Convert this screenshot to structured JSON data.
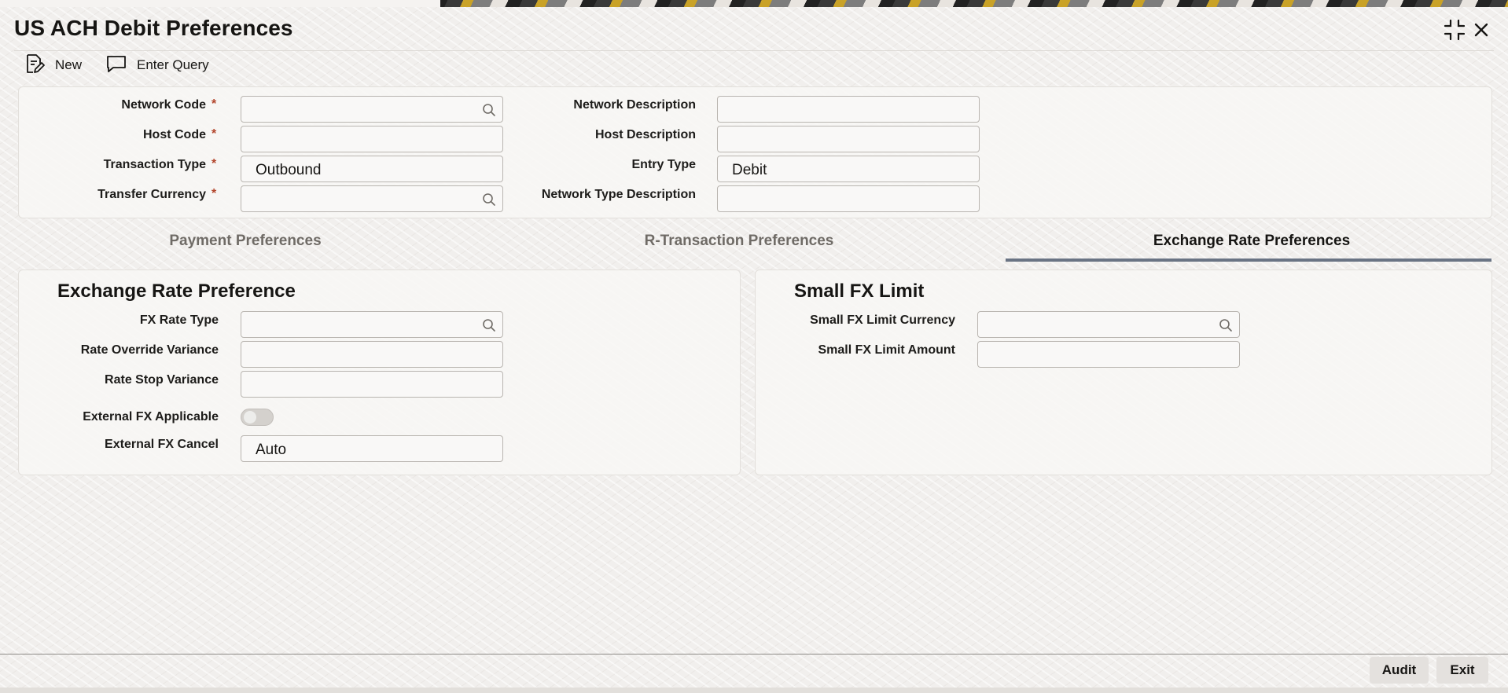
{
  "window": {
    "title": "US ACH Debit Preferences"
  },
  "toolbar": {
    "new_label": "New",
    "enter_query_label": "Enter Query"
  },
  "header_form": {
    "network_code": {
      "label": "Network Code",
      "required": "*",
      "value": ""
    },
    "host_code": {
      "label": "Host Code",
      "required": "*",
      "value": ""
    },
    "transaction_type": {
      "label": "Transaction Type",
      "required": "*",
      "value": "Outbound"
    },
    "transfer_currency": {
      "label": "Transfer Currency",
      "required": "*",
      "value": ""
    },
    "network_description": {
      "label": "Network Description",
      "value": ""
    },
    "host_description": {
      "label": "Host Description",
      "value": ""
    },
    "entry_type": {
      "label": "Entry Type",
      "value": "Debit"
    },
    "network_type_description": {
      "label": "Network Type Description",
      "value": ""
    }
  },
  "tabs": [
    {
      "label": "Payment Preferences",
      "active": false
    },
    {
      "label": "R-Transaction Preferences",
      "active": false
    },
    {
      "label": "Exchange Rate Preferences",
      "active": true
    }
  ],
  "exchange_rate_preference": {
    "title": "Exchange Rate Preference",
    "fx_rate_type": {
      "label": "FX Rate Type",
      "value": ""
    },
    "rate_override_variance": {
      "label": "Rate Override Variance",
      "value": ""
    },
    "rate_stop_variance": {
      "label": "Rate Stop Variance",
      "value": ""
    },
    "external_fx_applicable": {
      "label": "External FX Applicable",
      "checked": false
    },
    "external_fx_cancel": {
      "label": "External FX Cancel",
      "value": "Auto"
    }
  },
  "small_fx_limit": {
    "title": "Small FX Limit",
    "currency": {
      "label": "Small FX Limit Currency",
      "value": ""
    },
    "amount": {
      "label": "Small FX Limit Amount",
      "value": ""
    }
  },
  "footer": {
    "audit_label": "Audit",
    "exit_label": "Exit"
  },
  "colors": {
    "required": "#b2442a",
    "active_tab_underline": "#6a7484",
    "field_border": "#b9b5b0"
  }
}
